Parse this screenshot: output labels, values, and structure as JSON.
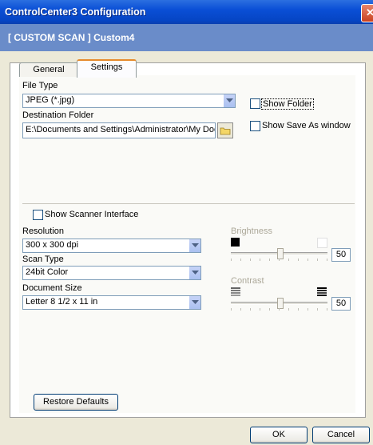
{
  "window": {
    "title": "ControlCenter3 Configuration",
    "close_glyph": "✕"
  },
  "header": {
    "text": "[ CUSTOM SCAN ]   Custom4"
  },
  "tabs": [
    {
      "label": "General"
    },
    {
      "label": "Settings",
      "selected": true
    }
  ],
  "settings": {
    "file_type_label": "File Type",
    "file_type_value": "JPEG (*.jpg)",
    "destination_label": "Destination Folder",
    "destination_value": "E:\\Documents and Settings\\Administrator\\My Docum",
    "show_folder_label": "Show Folder",
    "show_save_as_label": "Show Save As window",
    "show_scanner_label": "Show Scanner Interface",
    "resolution_label": "Resolution",
    "resolution_value": "300 x 300 dpi",
    "scan_type_label": "Scan Type",
    "scan_type_value": "24bit Color",
    "document_size_label": "Document Size",
    "document_size_value": "Letter 8 1/2 x 11 in",
    "brightness_label": "Brightness",
    "brightness_value": "50",
    "contrast_label": "Contrast",
    "contrast_value": "50",
    "restore_defaults_label": "Restore Defaults"
  },
  "footer": {
    "ok_label": "OK",
    "cancel_label": "Cancel"
  },
  "icons": [
    "close-icon",
    "dropdown-arrow-icon",
    "folder-icon",
    "brightness-low-icon",
    "brightness-high-icon",
    "contrast-low-icon",
    "contrast-high-icon"
  ],
  "colors": {
    "titlebar": "#0a4fd6",
    "header_band": "#6a8cc9",
    "tab_highlight": "#e68b2c"
  }
}
